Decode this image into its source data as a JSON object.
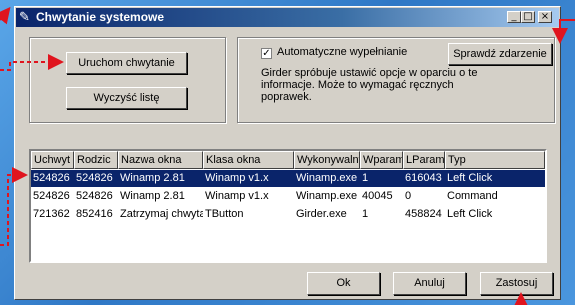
{
  "window": {
    "title": "Chwytanie systemowe",
    "controls": {
      "minimize": "_",
      "maximize": "□",
      "close": "×"
    }
  },
  "buttons": {
    "start_capture": "Uruchom chwytanie",
    "clear_list": "Wyczyść listę",
    "check_event": "Sprawdź zdarzenie",
    "ok": "Ok",
    "cancel": "Anuluj",
    "apply": "Zastosuj"
  },
  "autofill": {
    "checked": true,
    "label": "Automatyczne wypełnianie",
    "description": "Girder spróbuje ustawić opcje w oparciu o te informacje. Może to wymagać ręcznych poprawek."
  },
  "table": {
    "columns": [
      "Uchwyt",
      "Rodzic",
      "Nazwa okna",
      "Klasa okna",
      "Wykonywalny",
      "Wparam",
      "LParam",
      "Typ"
    ],
    "rows": [
      [
        "524826",
        "524826",
        "Winamp 2.81",
        "Winamp v1.x",
        "Winamp.exe",
        "1",
        "616043",
        "Left Click"
      ],
      [
        "524826",
        "524826",
        "Winamp 2.81",
        "Winamp v1.x",
        "Winamp.exe",
        "40045",
        "0",
        "Command"
      ],
      [
        "721362",
        "852416",
        "Zatrzymaj chwytanie",
        "TButton",
        "Girder.exe",
        "1",
        "458824",
        "Left Click"
      ]
    ],
    "selected_row": 0
  },
  "colors": {
    "title_bar": "#0a246a",
    "selection": "#0a246a",
    "annotation_arrow": "#e0141e",
    "background": "#3a86d2"
  }
}
